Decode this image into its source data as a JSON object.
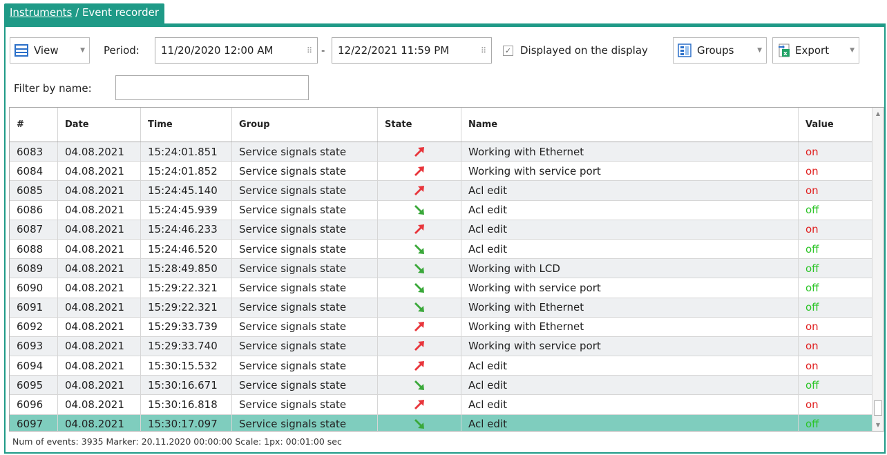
{
  "breadcrumb": {
    "link": "Instruments",
    "separator": " / ",
    "current": "Event recorder"
  },
  "toolbar": {
    "view_label": "View",
    "period_label": "Period:",
    "period_from": "11/20/2020 12:00 AM",
    "period_dash": "-",
    "period_to": "12/22/2021 11:59 PM",
    "displayed_label": "Displayed on the display",
    "displayed_checked": true,
    "groups_label": "Groups",
    "export_label": "Export",
    "filter_label": "Filter by name:",
    "filter_value": ""
  },
  "table": {
    "columns": [
      "#",
      "Date",
      "Time",
      "Group",
      "State",
      "Name",
      "Value"
    ],
    "rows": [
      {
        "num": "6083",
        "date": "04.08.2021",
        "time": "15:24:01.851",
        "group": "Service signals state",
        "state": "up",
        "name": "Working with Ethernet",
        "value": "on"
      },
      {
        "num": "6084",
        "date": "04.08.2021",
        "time": "15:24:01.852",
        "group": "Service signals state",
        "state": "up",
        "name": "Working with service port",
        "value": "on"
      },
      {
        "num": "6085",
        "date": "04.08.2021",
        "time": "15:24:45.140",
        "group": "Service signals state",
        "state": "up",
        "name": "Acl edit",
        "value": "on"
      },
      {
        "num": "6086",
        "date": "04.08.2021",
        "time": "15:24:45.939",
        "group": "Service signals state",
        "state": "down",
        "name": "Acl edit",
        "value": "off"
      },
      {
        "num": "6087",
        "date": "04.08.2021",
        "time": "15:24:46.233",
        "group": "Service signals state",
        "state": "up",
        "name": "Acl edit",
        "value": "on"
      },
      {
        "num": "6088",
        "date": "04.08.2021",
        "time": "15:24:46.520",
        "group": "Service signals state",
        "state": "down",
        "name": "Acl edit",
        "value": "off"
      },
      {
        "num": "6089",
        "date": "04.08.2021",
        "time": "15:28:49.850",
        "group": "Service signals state",
        "state": "down",
        "name": "Working with LCD",
        "value": "off"
      },
      {
        "num": "6090",
        "date": "04.08.2021",
        "time": "15:29:22.321",
        "group": "Service signals state",
        "state": "down",
        "name": "Working with service port",
        "value": "off"
      },
      {
        "num": "6091",
        "date": "04.08.2021",
        "time": "15:29:22.321",
        "group": "Service signals state",
        "state": "down",
        "name": "Working with Ethernet",
        "value": "off"
      },
      {
        "num": "6092",
        "date": "04.08.2021",
        "time": "15:29:33.739",
        "group": "Service signals state",
        "state": "up",
        "name": "Working with Ethernet",
        "value": "on"
      },
      {
        "num": "6093",
        "date": "04.08.2021",
        "time": "15:29:33.740",
        "group": "Service signals state",
        "state": "up",
        "name": "Working with service port",
        "value": "on"
      },
      {
        "num": "6094",
        "date": "04.08.2021",
        "time": "15:30:15.532",
        "group": "Service signals state",
        "state": "up",
        "name": "Acl edit",
        "value": "on"
      },
      {
        "num": "6095",
        "date": "04.08.2021",
        "time": "15:30:16.671",
        "group": "Service signals state",
        "state": "down",
        "name": "Acl edit",
        "value": "off"
      },
      {
        "num": "6096",
        "date": "04.08.2021",
        "time": "15:30:16.818",
        "group": "Service signals state",
        "state": "up",
        "name": "Acl edit",
        "value": "on"
      },
      {
        "num": "6097",
        "date": "04.08.2021",
        "time": "15:30:17.097",
        "group": "Service signals state",
        "state": "down",
        "name": "Acl edit",
        "value": "off",
        "selected": true
      }
    ]
  },
  "status": "Num of events: 3935  Marker: 20.11.2020 00:00:00  Scale: 1px: 00:01:00 sec",
  "colors": {
    "accent": "#1f9a87",
    "selected_row": "#7fcdbe",
    "on": "#e02020",
    "off": "#2bc427",
    "arrow_up": "#e8353b",
    "arrow_down": "#3aa83a"
  },
  "icons": {
    "view": "view-icon",
    "calendar": "calendar-icon",
    "groups": "groups-icon",
    "export": "export-icon",
    "state_up": "arrow-up-right-icon",
    "state_down": "arrow-down-right-icon"
  }
}
